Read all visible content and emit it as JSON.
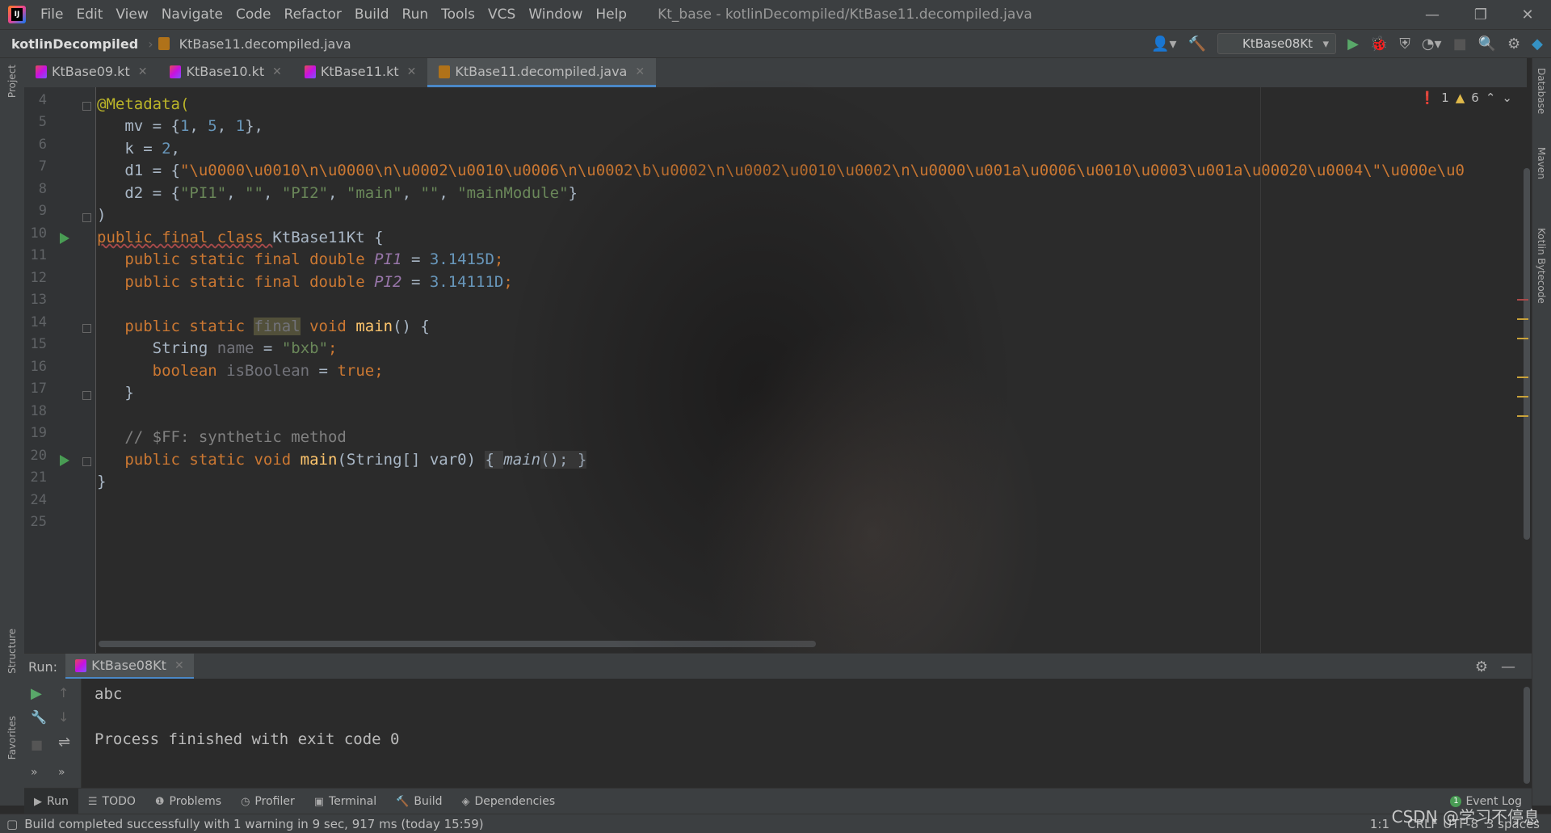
{
  "menu": {
    "items": [
      "File",
      "Edit",
      "View",
      "Navigate",
      "Code",
      "Refactor",
      "Build",
      "Run",
      "Tools",
      "VCS",
      "Window",
      "Help"
    ],
    "title": "Kt_base - kotlinDecompiled/KtBase11.decompiled.java"
  },
  "nav": {
    "project": "kotlinDecompiled",
    "file": "KtBase11.decompiled.java",
    "run_config": "KtBase08Kt"
  },
  "tabs": [
    {
      "label": "KtBase09.kt"
    },
    {
      "label": "KtBase10.kt"
    },
    {
      "label": "KtBase11.kt"
    },
    {
      "label": "KtBase11.decompiled.java"
    }
  ],
  "left_strip": {
    "project": "Project",
    "structure": "Structure",
    "favorites": "Favorites"
  },
  "right_strip": {
    "database": "Database",
    "maven": "Maven",
    "bytecode": "Kotlin Bytecode"
  },
  "inspections": {
    "errors": "1",
    "warnings": "6"
  },
  "code": {
    "line_numbers": [
      "4",
      "5",
      "6",
      "7",
      "8",
      "9",
      "10",
      "11",
      "12",
      "13",
      "14",
      "15",
      "16",
      "17",
      "18",
      "19",
      "20",
      "21",
      "24",
      "25"
    ],
    "l5": "@Metadata(",
    "l6_a": "   mv = {",
    "l6_b": "1",
    "l6_c": ", ",
    "l6_d": "5",
    "l6_e": ", ",
    "l6_f": "1",
    "l6_g": "},",
    "l7_a": "   k = ",
    "l7_b": "2",
    "l7_c": ",",
    "l8_a": "   d1 = {",
    "l8_b": "\"\\u0000\\u0010\\n\\u0000\\n\\u0002\\u0010\\u0006\\n\\u0002\\b\\u0002\\n\\u0002\\u0010\\u0002\\n\\u0000\\u001a\\u0006\\u0010\\u0003\\u001a\\u00020\\u0004\\\"\\u000e\\u0",
    "l9_a": "   d2 = {",
    "l9_b": "\"PI1\"",
    "l9_c": ", ",
    "l9_d": "\"\"",
    "l9_e": ", ",
    "l9_f": "\"PI2\"",
    "l9_g": ", ",
    "l9_h": "\"main\"",
    "l9_i": ", ",
    "l9_j": "\"\"",
    "l9_k": ", ",
    "l9_l": "\"mainModule\"",
    "l9_m": "}",
    "l10": ")",
    "l11_a": "public final class ",
    "l11_b": "KtBase11Kt {",
    "l12_a": "   public static final double ",
    "l12_b": "PI1",
    "l12_c": " = ",
    "l12_d": "3.1415D",
    "l12_e": ";",
    "l13_a": "   public static final double ",
    "l13_b": "PI2",
    "l13_c": " = ",
    "l13_d": "3.14111D",
    "l13_e": ";",
    "l15_a": "   public static ",
    "l15_b": "final",
    "l15_c": " void ",
    "l15_d": "main",
    "l15_e": "() {",
    "l16_a": "      String ",
    "l16_b": "name",
    "l16_c": " = ",
    "l16_d": "\"bxb\"",
    "l16_e": ";",
    "l17_a": "      boolean ",
    "l17_b": "isBoolean",
    "l17_c": " = ",
    "l17_d": "true",
    "l17_e": ";",
    "l18": "   }",
    "l20": "   // $FF: synthetic method",
    "l21_a": "   public static void ",
    "l21_b": "main",
    "l21_c": "(String[] var0) ",
    "l21_d": "{ ",
    "l21_e": "main",
    "l21_f": "(); }",
    "l24": "}"
  },
  "run": {
    "label": "Run:",
    "tab": "KtBase08Kt",
    "output": [
      "abc",
      "",
      "Process finished with exit code 0"
    ]
  },
  "toolwindows": [
    {
      "label": "Run",
      "icon": "play-icon"
    },
    {
      "label": "TODO",
      "icon": "todo-icon"
    },
    {
      "label": "Problems",
      "icon": "problems-icon"
    },
    {
      "label": "Profiler",
      "icon": "profiler-icon"
    },
    {
      "label": "Terminal",
      "icon": "terminal-icon"
    },
    {
      "label": "Build",
      "icon": "build-icon"
    },
    {
      "label": "Dependencies",
      "icon": "dependencies-icon"
    }
  ],
  "event_log": {
    "count": "1",
    "label": "Event Log"
  },
  "status": {
    "message": "Build completed successfully with 1 warning in 9 sec, 917 ms (today 15:59)",
    "position": "1:1",
    "line_sep": "CRLF",
    "encoding": "UTF-8",
    "indent": "3 spaces"
  },
  "watermark": "CSDN @学习不停息",
  "colors": {
    "accent": "#4a88c7",
    "keyword": "#cc7832",
    "string": "#6a8759",
    "number": "#6897bb",
    "annotation": "#bbb529"
  }
}
